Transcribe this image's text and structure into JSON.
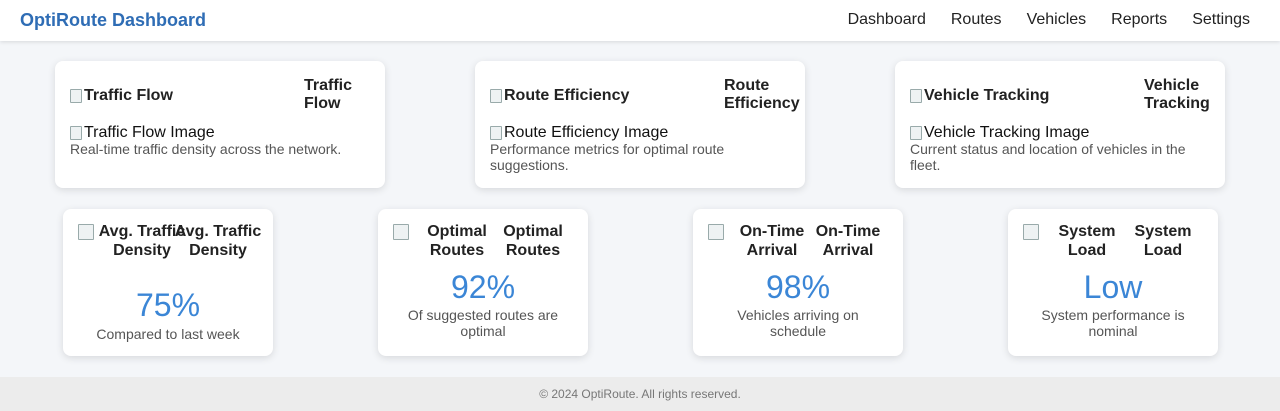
{
  "header": {
    "brand": "OptiRoute Dashboard",
    "nav": [
      "Dashboard",
      "Routes",
      "Vehicles",
      "Reports",
      "Settings"
    ]
  },
  "feature_cards": [
    {
      "icon_alt": "Traffic Flow",
      "title": "Traffic Flow",
      "image_alt": "Traffic Flow Image",
      "description": "Real-time traffic density across the network."
    },
    {
      "icon_alt": "Route Efficiency",
      "title": "Route Efficiency",
      "image_alt": "Route Efficiency Image",
      "description": "Performance metrics for optimal route suggestions."
    },
    {
      "icon_alt": "Vehicle Tracking",
      "title": "Vehicle Tracking",
      "image_alt": "Vehicle Tracking Image",
      "description": "Current status and location of vehicles in the fleet."
    }
  ],
  "metric_cards": [
    {
      "icon_alt": "Avg. Traffic Density",
      "title": "Avg. Traffic Density",
      "value": "75%",
      "subtitle": "Compared to last week"
    },
    {
      "icon_alt": "Optimal Routes",
      "title": "Optimal Routes",
      "value": "92%",
      "subtitle": "Of suggested routes are optimal"
    },
    {
      "icon_alt": "On-Time Arrival",
      "title": "On-Time Arrival",
      "value": "98%",
      "subtitle": "Vehicles arriving on schedule"
    },
    {
      "icon_alt": "System Load",
      "title": "System Load",
      "value": "Low",
      "subtitle": "System performance is nominal"
    }
  ],
  "footer": {
    "text": "© 2024 OptiRoute. All rights reserved."
  },
  "colors": {
    "brand": "#2f6db5",
    "metric_value": "#3b86d6"
  }
}
